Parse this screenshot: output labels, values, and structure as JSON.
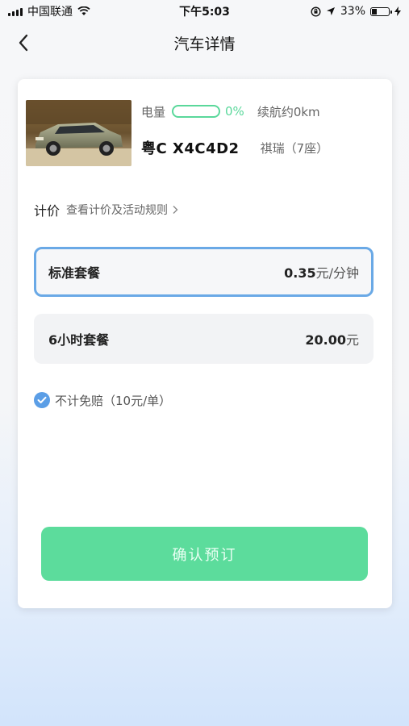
{
  "status_bar": {
    "carrier": "中国联通",
    "time": "下午5:03",
    "battery_text": "33%",
    "battery_level": 0.33,
    "icons": [
      "signal-icon",
      "wifi-icon",
      "lock-rotation-icon",
      "location-arrow-icon",
      "battery-icon",
      "charging-icon"
    ]
  },
  "nav": {
    "title": "汽车详情",
    "back_icon": "chevron-left-icon"
  },
  "car": {
    "battery_label": "电量",
    "battery_percent": "0%",
    "battery_level": 0,
    "range": "续航约0km",
    "plate": "粤C X4C4D2",
    "model": "祺瑞（7座）"
  },
  "pricing": {
    "label": "计价",
    "rules_link": "查看计价及活动规则",
    "rules_link_icon": "chevron-right-icon"
  },
  "packages": [
    {
      "name": "标准套餐",
      "price": "0.35",
      "unit": "元/分钟",
      "selected": true
    },
    {
      "name": "6小时套餐",
      "price": "20.00",
      "unit": "元",
      "selected": false
    }
  ],
  "insurance": {
    "label": "不计免赔（10元/单）",
    "checked": true
  },
  "confirm_button": "确认预订",
  "colors": {
    "accent_green": "#5cdc9c",
    "selected_border": "#6aa9e6",
    "check_blue": "#5b9ee6",
    "battery_green": "#5ad89b"
  }
}
